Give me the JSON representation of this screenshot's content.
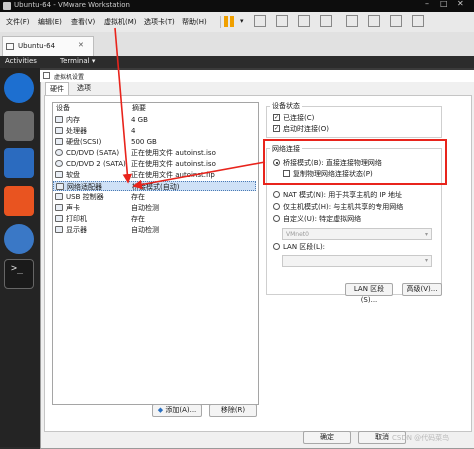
{
  "app": {
    "window_title": "Ubuntu-64 - VMware Workstation",
    "menu": [
      "文件(F)",
      "编辑(E)",
      "查看(V)",
      "虚拟机(M)",
      "选项卡(T)",
      "帮助(H)"
    ],
    "vm_tab": "Ubuntu-64",
    "terminal_tab": "Terminal",
    "activities": "Activities"
  },
  "dialog": {
    "title": "虚拟机设置",
    "tabs": [
      "硬件",
      "选项"
    ],
    "list_headers": {
      "device": "设备",
      "summary": "摘要"
    },
    "devices": [
      {
        "name": "内存",
        "summary": "4 GB",
        "icon": "memory-icon"
      },
      {
        "name": "处理器",
        "summary": "4",
        "icon": "cpu-icon"
      },
      {
        "name": "硬盘(SCSI)",
        "summary": "500 GB",
        "icon": "disk-icon"
      },
      {
        "name": "CD/DVD (SATA)",
        "summary": "正在使用文件 autoinst.iso",
        "icon": "cd-icon"
      },
      {
        "name": "CD/DVD 2 (SATA)",
        "summary": "正在使用文件 autoinst.iso",
        "icon": "cd-icon"
      },
      {
        "name": "软盘",
        "summary": "正在使用文件 autoinst.flp",
        "icon": "floppy-icon"
      },
      {
        "name": "网络适配器",
        "summary": "桥接模式(自动)",
        "icon": "network-icon",
        "selected": true
      },
      {
        "name": "USB 控制器",
        "summary": "存在",
        "icon": "usb-icon"
      },
      {
        "name": "声卡",
        "summary": "自动检测",
        "icon": "sound-icon"
      },
      {
        "name": "打印机",
        "summary": "存在",
        "icon": "printer-icon"
      },
      {
        "name": "显示器",
        "summary": "自动检测",
        "icon": "monitor-icon"
      }
    ],
    "add_button": "添加(A)...",
    "remove_button": "移除(R)",
    "device_status": {
      "title": "设备状态",
      "connected": {
        "label": "已连接(C)",
        "checked": true
      },
      "connect_at_power_on": {
        "label": "启动时连接(O)",
        "checked": true
      }
    },
    "network": {
      "title": "网络连接",
      "bridged": {
        "label": "桥接模式(B): 直接连接物理网络",
        "selected": true
      },
      "replicate": {
        "label": "复制物理网络连接状态(P)",
        "checked": false
      },
      "nat": {
        "label": "NAT 模式(N): 用于共享主机的 IP 地址",
        "selected": false
      },
      "host_only": {
        "label": "仅主机模式(H): 与主机共享的专用网络",
        "selected": false
      },
      "custom": {
        "label": "自定义(U): 特定虚拟网络",
        "selected": false
      },
      "vmnet_value": "VMnet0",
      "lan": {
        "label": "LAN 区段(L):",
        "selected": false
      }
    },
    "lan_segments_button": "LAN 区段(S)...",
    "advanced_button": "高级(V)...",
    "ok_button": "确定",
    "cancel_button": "取消"
  },
  "watermark": "CSDN @代码菜鸟",
  "colors": {
    "highlight_box": "#e8241c",
    "annotation_arrow": "#e8241c"
  }
}
